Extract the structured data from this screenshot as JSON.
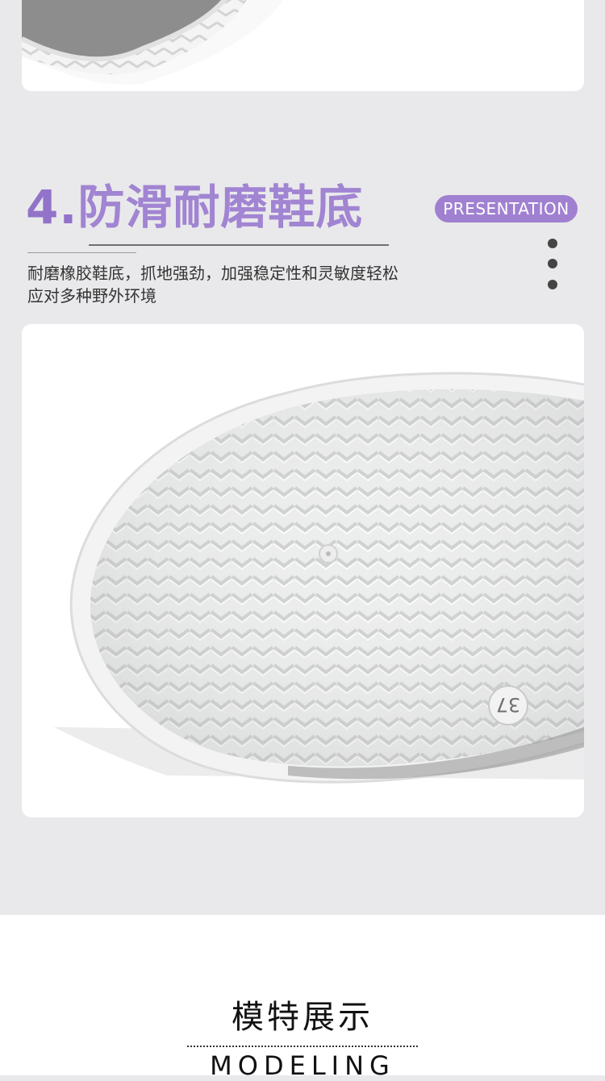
{
  "section": {
    "number": "4.",
    "title": "防滑耐磨鞋底",
    "badge": "PRESENTATION",
    "description_line1": "耐磨橡胶鞋底，抓地强劲，加强稳定性和灵敏度轻松",
    "description_line2": "应对多种野外环境"
  },
  "images": {
    "top": "sneaker-sole-detail-photo",
    "main": "shoe-sole-tread-photo",
    "sole_size_mark": "37"
  },
  "footer": {
    "title": "模特展示",
    "subtitle": "MODELING"
  },
  "colors": {
    "accent": "#9273c9",
    "badge_bg": "#a080d0",
    "page_bg": "#e9e9eb",
    "card_bg": "#ffffff"
  }
}
